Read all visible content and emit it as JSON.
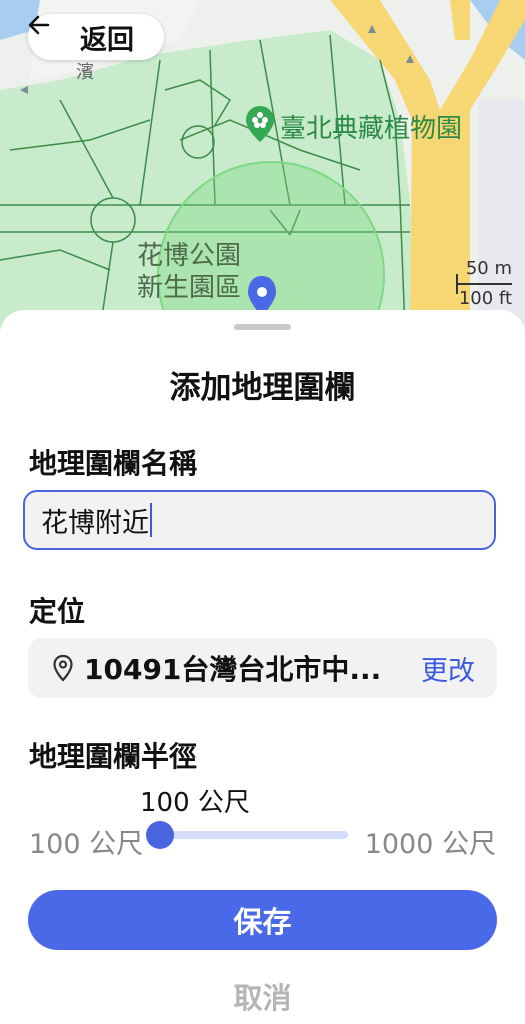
{
  "header": {
    "back_label": "返回"
  },
  "map": {
    "poi_label": "臺北典藏植物園",
    "area_label_line1": "花博公園",
    "area_label_line2": "新生園區",
    "partial_road_label": "濱",
    "scale_metric": "50 m",
    "scale_imperial": "100 ft",
    "colors": {
      "park": "#c8ebcb",
      "road_yellow": "#f6d774",
      "geofence": "#7fd884",
      "pin": "#4a69e8"
    }
  },
  "sheet": {
    "title": "添加地理圍欄",
    "name_label": "地理圍欄名稱",
    "name_value": "花博附近",
    "location_label": "定位",
    "location_address": "10491台灣台北市中...",
    "location_change": "更改",
    "radius_label": "地理圍欄半徑",
    "radius_value": "100 公尺",
    "radius_min": "100 公尺",
    "radius_max": "1000 公尺",
    "radius_fraction": 0.0,
    "save_label": "保存",
    "cancel_label": "取消"
  },
  "accent_color": "#4a69e8"
}
